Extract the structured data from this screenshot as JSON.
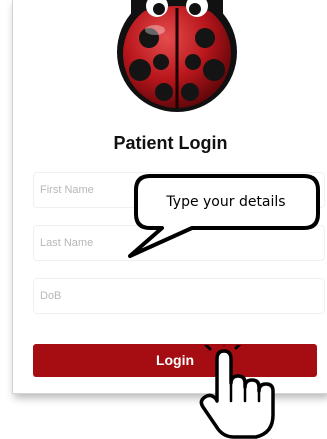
{
  "login": {
    "title": "Patient Login",
    "fields": [
      {
        "placeholder": "First Name",
        "value": ""
      },
      {
        "placeholder": "Last Name",
        "value": ""
      },
      {
        "placeholder": "DoB",
        "value": ""
      }
    ],
    "button_label": "Login"
  },
  "annotation": {
    "callout_text": "Type your details"
  },
  "colors": {
    "button": "#a50d12",
    "ladybug_red": "#b8161c"
  },
  "icons": {
    "logo": "ladybug-icon",
    "cursor": "hand-pointer-icon"
  }
}
